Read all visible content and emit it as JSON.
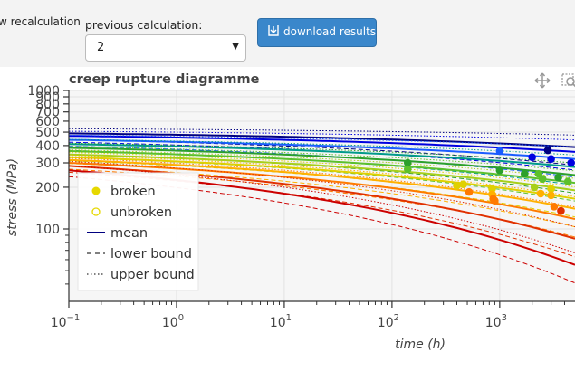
{
  "controls": {
    "new_recalc_label": "w recalculation",
    "previous_label": "previous calculation:",
    "previous_value": "2",
    "download_label": "download results"
  },
  "chart_data": {
    "type": "line",
    "title": "creep rupture diagramme",
    "xlabel": "time (h)",
    "ylabel": "stress (MPa)",
    "xscale": "log",
    "yscale": "log",
    "xlim": [
      0.1,
      5000
    ],
    "ylim": [
      30,
      1000
    ],
    "x_ticks": [
      {
        "value": 0.1,
        "base": "10",
        "exp": "−1"
      },
      {
        "value": 1,
        "base": "10",
        "exp": "0"
      },
      {
        "value": 10,
        "base": "10",
        "exp": "1"
      },
      {
        "value": 100,
        "base": "10",
        "exp": "2"
      },
      {
        "value": 1000,
        "base": "10",
        "exp": "3"
      }
    ],
    "y_tick_labels": [
      "100",
      "200",
      "300",
      "400",
      "500",
      "600",
      "700",
      "800",
      "900",
      "1000"
    ],
    "legend": {
      "position": "bottom-left",
      "items": [
        {
          "label": "broken",
          "symbol": "filled-circle"
        },
        {
          "label": "unbroken",
          "symbol": "open-circle"
        },
        {
          "label": "mean",
          "symbol": "solid-line"
        },
        {
          "label": "lower bound",
          "symbol": "dashed-line"
        },
        {
          "label": "upper bound",
          "symbol": "dotted-line"
        }
      ]
    },
    "series": [
      {
        "color": "#000080",
        "mean_y_at_0_1": 490,
        "mean_y_at_5000": 390
      },
      {
        "color": "#0000e0",
        "mean_y_at_0_1": 470,
        "mean_y_at_5000": 360
      },
      {
        "color": "#1a5cff",
        "mean_y_at_0_1": 440,
        "mean_y_at_5000": 320
      },
      {
        "color": "#009a8a",
        "mean_y_at_0_1": 410,
        "mean_y_at_5000": 280
      },
      {
        "color": "#2ca02c",
        "mean_y_at_0_1": 385,
        "mean_y_at_5000": 245
      },
      {
        "color": "#5cc02c",
        "mean_y_at_0_1": 365,
        "mean_y_at_5000": 215
      },
      {
        "color": "#a8cf1a",
        "mean_y_at_0_1": 345,
        "mean_y_at_5000": 190
      },
      {
        "color": "#e0d000",
        "mean_y_at_0_1": 330,
        "mean_y_at_5000": 165
      },
      {
        "color": "#ffb000",
        "mean_y_at_0_1": 315,
        "mean_y_at_5000": 140
      },
      {
        "color": "#ff7a00",
        "mean_y_at_0_1": 300,
        "mean_y_at_5000": 118
      },
      {
        "color": "#e03000",
        "mean_y_at_0_1": 285,
        "mean_y_at_5000": 85
      },
      {
        "color": "#cc0000",
        "mean_y_at_0_1": 265,
        "mean_y_at_5000": 55
      }
    ],
    "points": [
      {
        "x": 140,
        "y": 300,
        "color": "#2ca02c"
      },
      {
        "x": 140,
        "y": 270,
        "color": "#5cc02c"
      },
      {
        "x": 400,
        "y": 205,
        "color": "#e0d000"
      },
      {
        "x": 460,
        "y": 210,
        "color": "#e0d000"
      },
      {
        "x": 520,
        "y": 185,
        "color": "#ff7a00"
      },
      {
        "x": 850,
        "y": 195,
        "color": "#e0d000"
      },
      {
        "x": 850,
        "y": 178,
        "color": "#ffb000"
      },
      {
        "x": 870,
        "y": 165,
        "color": "#ff7a00"
      },
      {
        "x": 900,
        "y": 160,
        "color": "#ff7a00"
      },
      {
        "x": 1000,
        "y": 265,
        "color": "#2ca02c"
      },
      {
        "x": 1000,
        "y": 365,
        "color": "#1a5cff"
      },
      {
        "x": 1700,
        "y": 250,
        "color": "#2ca02c"
      },
      {
        "x": 2000,
        "y": 330,
        "color": "#0000e0"
      },
      {
        "x": 2100,
        "y": 200,
        "color": "#a8cf1a"
      },
      {
        "x": 2300,
        "y": 250,
        "color": "#5cc02c"
      },
      {
        "x": 2400,
        "y": 180,
        "color": "#ffb000"
      },
      {
        "x": 2500,
        "y": 230,
        "color": "#5cc02c"
      },
      {
        "x": 2800,
        "y": 370,
        "color": "#000080"
      },
      {
        "x": 3000,
        "y": 320,
        "color": "#0000e0"
      },
      {
        "x": 3000,
        "y": 195,
        "color": "#e0d000"
      },
      {
        "x": 3000,
        "y": 175,
        "color": "#ffb000"
      },
      {
        "x": 3200,
        "y": 145,
        "color": "#ff7a00"
      },
      {
        "x": 3500,
        "y": 235,
        "color": "#2ca02c"
      },
      {
        "x": 3700,
        "y": 135,
        "color": "#e03000"
      },
      {
        "x": 4300,
        "y": 220,
        "color": "#5cc02c"
      },
      {
        "x": 4600,
        "y": 300,
        "color": "#0000e0"
      }
    ]
  }
}
